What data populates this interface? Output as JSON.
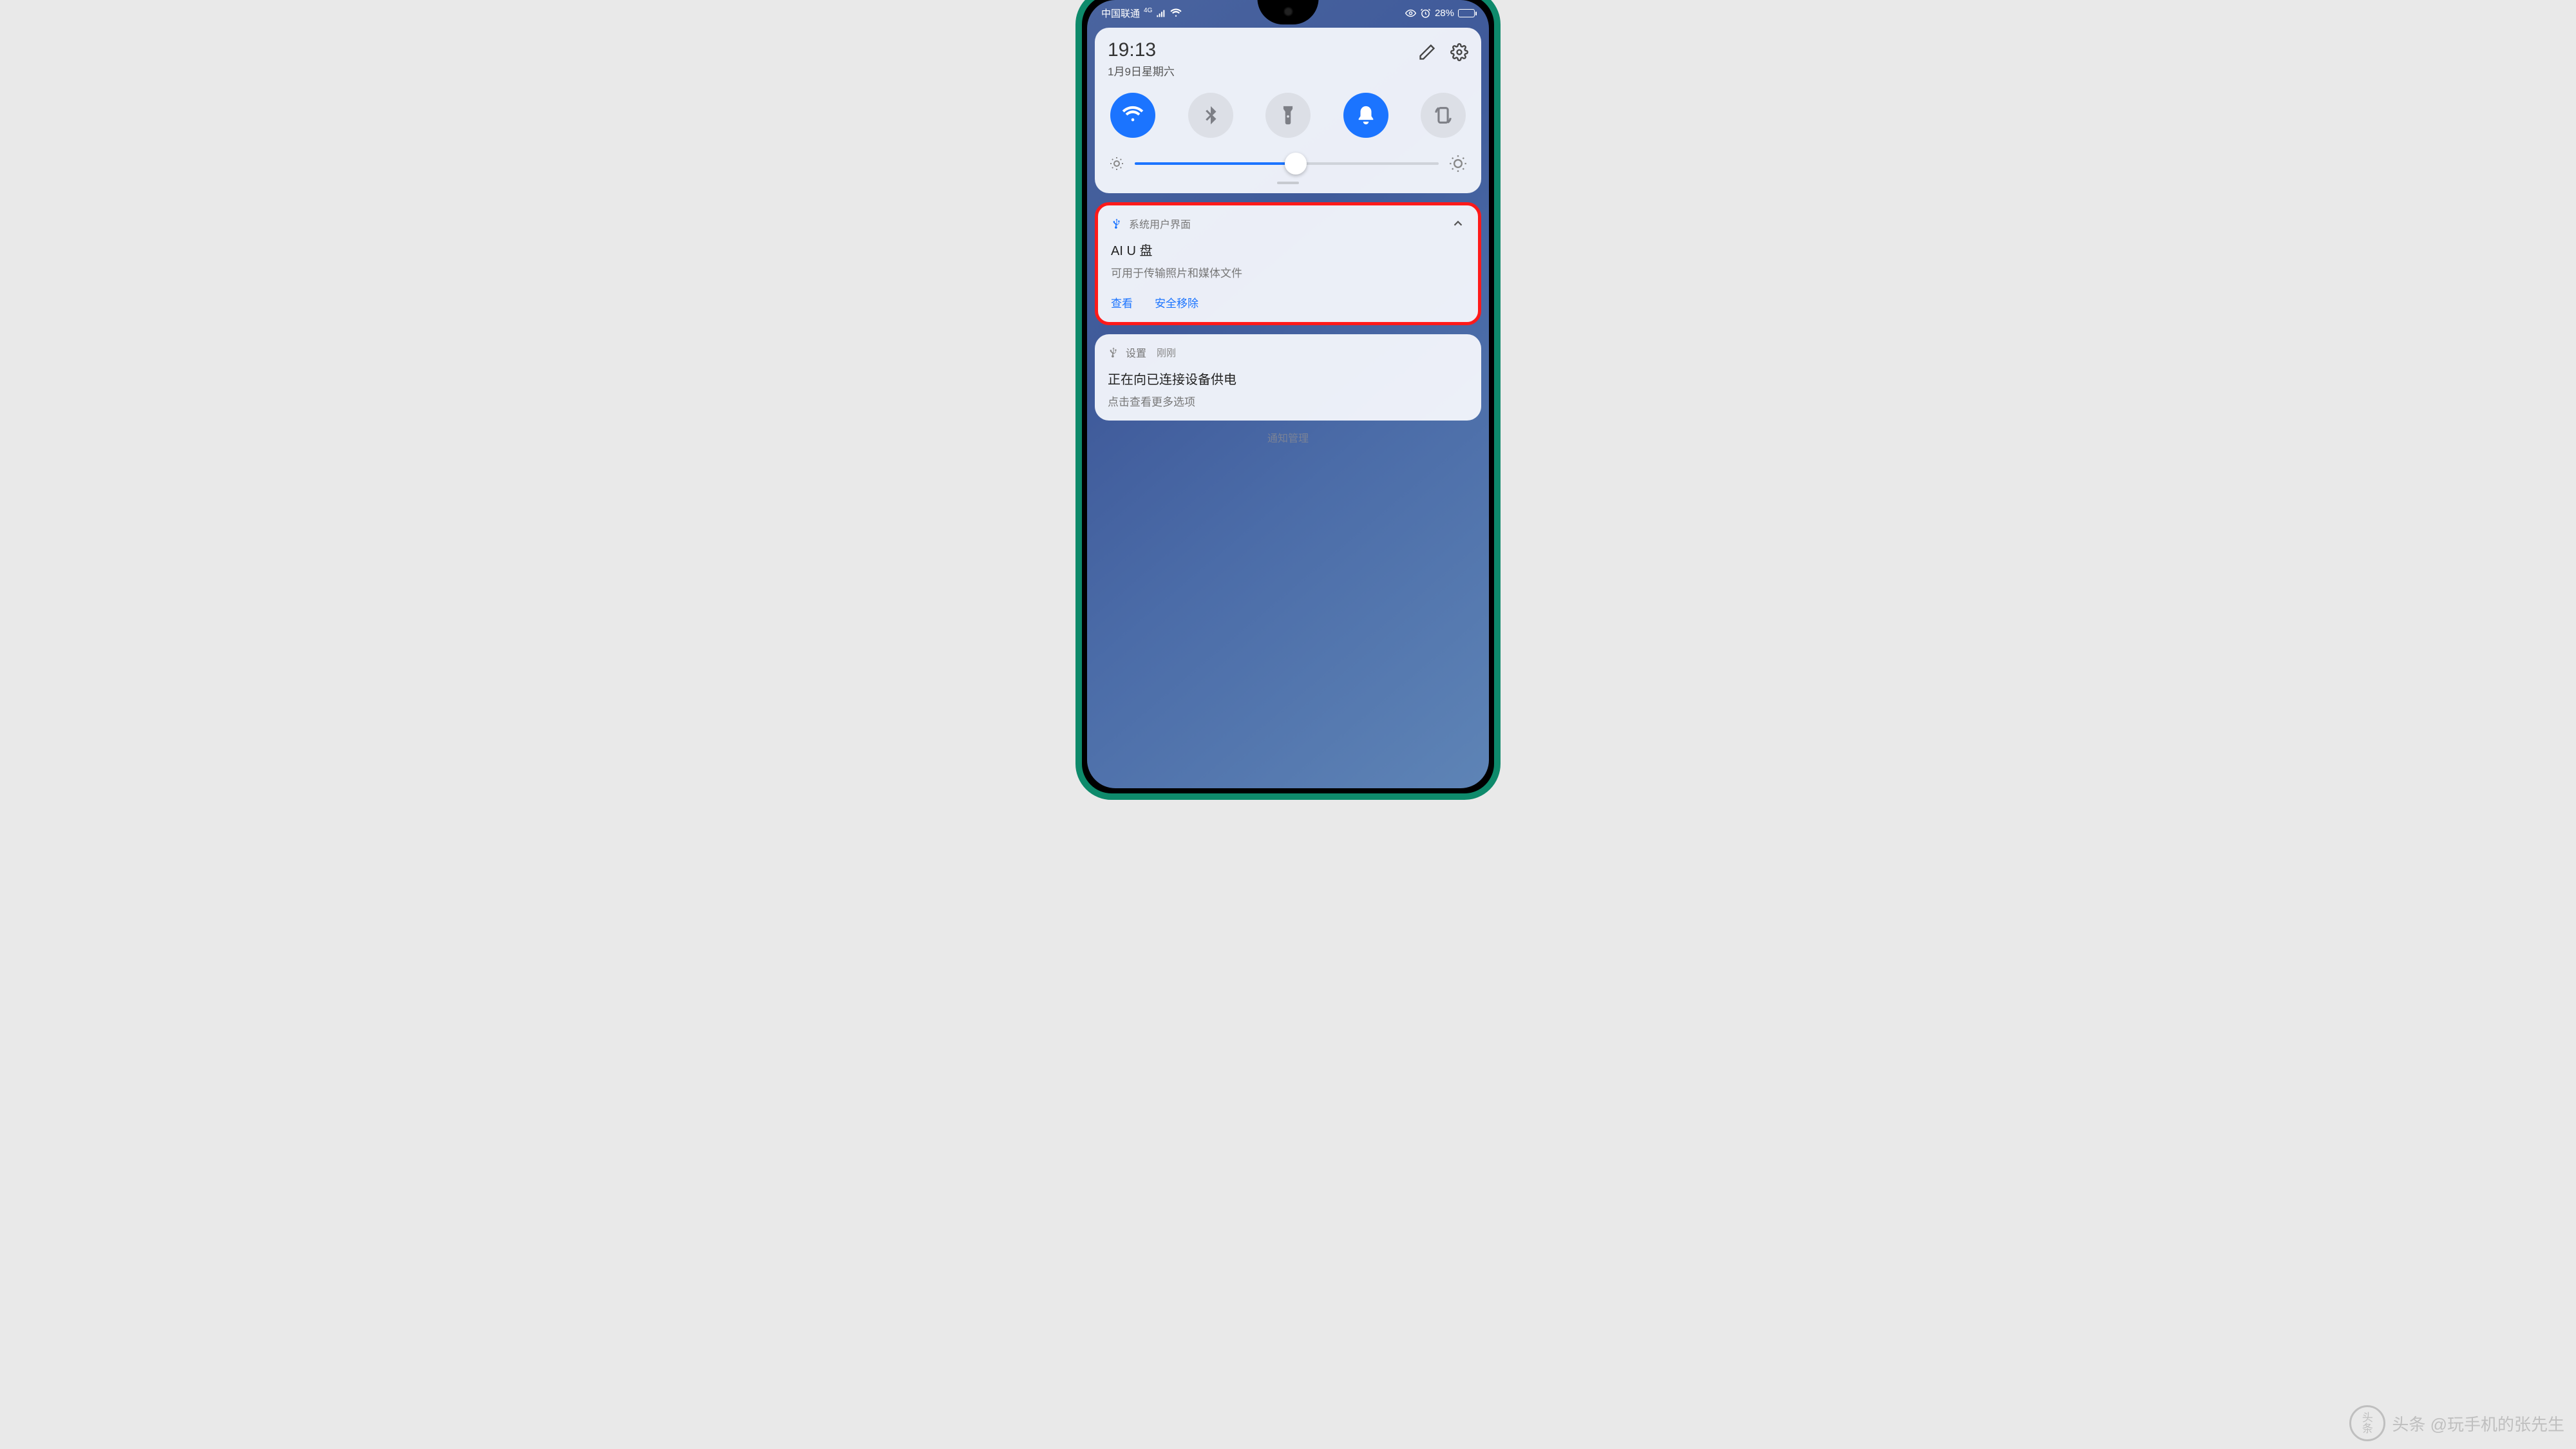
{
  "status": {
    "carrier": "中国联通",
    "network_badge": "4G",
    "battery_text": "28%"
  },
  "quick_settings": {
    "time": "19:13",
    "date": "1月9日星期六",
    "toggles": {
      "wifi_active": true,
      "bluetooth_active": false,
      "flashlight_active": false,
      "sound_active": true,
      "rotate_active": false
    },
    "brightness_percent": 53
  },
  "notifications": [
    {
      "app": "系统用户界面",
      "title": "AI U 盘",
      "desc": "可用于传输照片和媒体文件",
      "actions": [
        "查看",
        "安全移除"
      ],
      "highlighted": true
    },
    {
      "app": "设置",
      "time": "刚刚",
      "title": "正在向已连接设备供电",
      "desc": "点击查看更多选项",
      "highlighted": false
    }
  ],
  "footer_link": "通知管理",
  "watermark": {
    "badge_top": "头",
    "badge_bottom": "条",
    "text": "头条 @玩手机的张先生"
  }
}
